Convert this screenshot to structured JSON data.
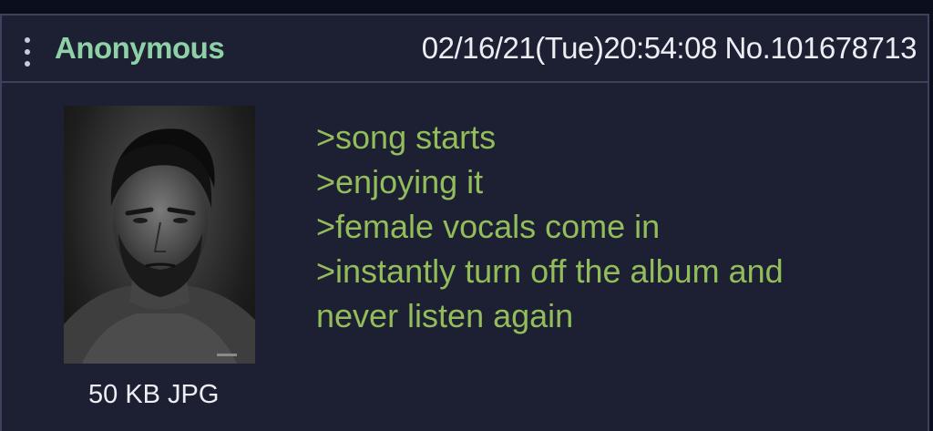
{
  "post": {
    "name": "Anonymous",
    "datetime": "02/16/21(Tue)20:54:08",
    "number": "No.101678713",
    "file_info": "50 KB JPG",
    "lines": [
      ">song starts",
      ">enjoying it",
      ">female vocals come in",
      ">instantly turn off the album and",
      "never listen again"
    ]
  },
  "icons": {
    "menu": "more-vertical-icon"
  },
  "colors": {
    "background": "#1c2032",
    "border": "#3c425c",
    "name": "#8fd1a6",
    "greentext": "#93bd5a",
    "text": "#eceef4"
  }
}
